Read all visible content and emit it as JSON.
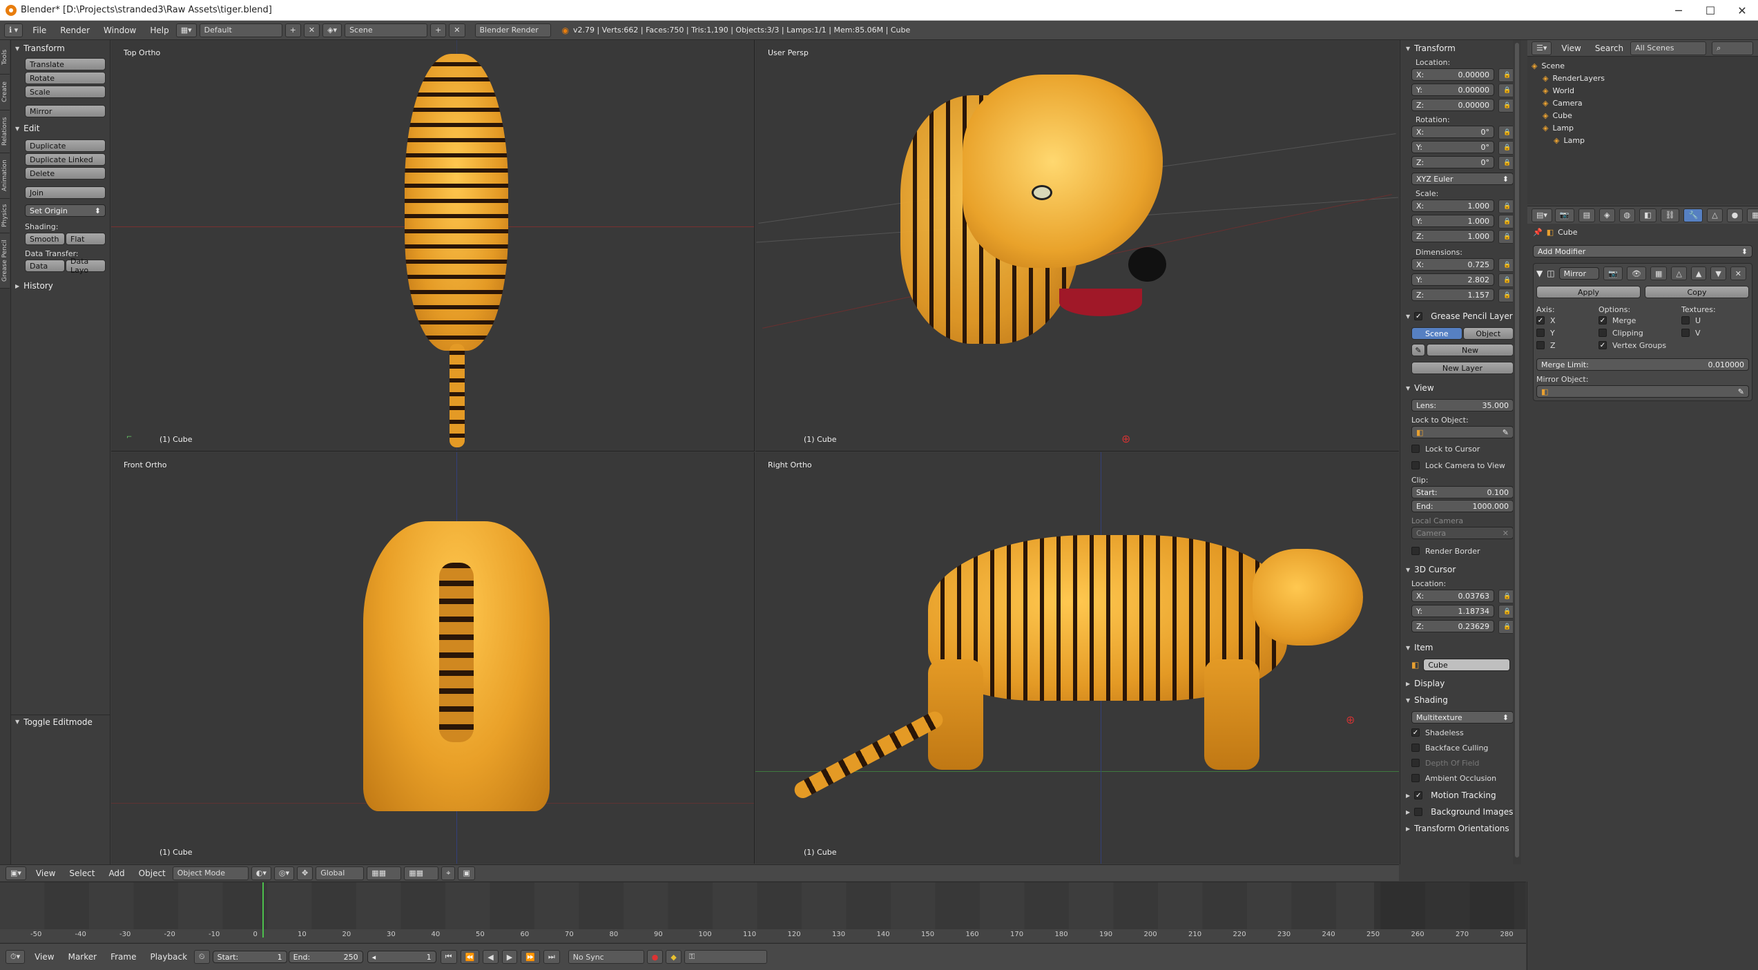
{
  "window": {
    "title": "Blender* [D:\\Projects\\stranded3\\Raw Assets\\tiger.blend]",
    "minimize": "─",
    "maximize": "☐",
    "close": "✕"
  },
  "infobar": {
    "menus": [
      "File",
      "Render",
      "Window",
      "Help"
    ],
    "layout": "Default",
    "scene": "Scene",
    "engine": "Blender Render",
    "stats": "v2.79 | Verts:662 | Faces:750 | Tris:1,190 | Objects:3/3 | Lamps:1/1 | Mem:85.06M | Cube"
  },
  "tools": {
    "tabs": [
      "Tools",
      "Create",
      "Relations",
      "Animation",
      "Physics",
      "Grease Pencil"
    ],
    "transform_header": "Transform",
    "transform": [
      "Translate",
      "Rotate",
      "Scale",
      "Mirror"
    ],
    "edit_header": "Edit",
    "edit": [
      "Duplicate",
      "Duplicate Linked",
      "Delete",
      "Join"
    ],
    "set_origin": "Set Origin",
    "shading_label": "Shading:",
    "shading": [
      "Smooth",
      "Flat"
    ],
    "data_transfer_label": "Data Transfer:",
    "data_transfer": [
      "Data",
      "Data Layo"
    ],
    "history": "History",
    "toggle_editmode": "Toggle Editmode"
  },
  "viewports": {
    "top": "Top Ortho",
    "persp": "User Persp",
    "front": "Front Ortho",
    "right": "Right Ortho",
    "object": "(1) Cube"
  },
  "view3d_header": {
    "menus": [
      "View",
      "Select",
      "Add",
      "Object"
    ],
    "mode": "Object Mode",
    "orientation": "Global"
  },
  "properties_n": {
    "transform": "Transform",
    "location_label": "Location:",
    "location": [
      {
        "axis": "X:",
        "value": "0.00000"
      },
      {
        "axis": "Y:",
        "value": "0.00000"
      },
      {
        "axis": "Z:",
        "value": "0.00000"
      }
    ],
    "rotation_label": "Rotation:",
    "rotation": [
      {
        "axis": "X:",
        "value": "0°"
      },
      {
        "axis": "Y:",
        "value": "0°"
      },
      {
        "axis": "Z:",
        "value": "0°"
      }
    ],
    "rotation_mode": "XYZ Euler",
    "scale_label": "Scale:",
    "scale": [
      {
        "axis": "X:",
        "value": "1.000"
      },
      {
        "axis": "Y:",
        "value": "1.000"
      },
      {
        "axis": "Z:",
        "value": "1.000"
      }
    ],
    "dimensions_label": "Dimensions:",
    "dimensions": [
      {
        "axis": "X:",
        "value": "0.725"
      },
      {
        "axis": "Y:",
        "value": "2.802"
      },
      {
        "axis": "Z:",
        "value": "1.157"
      }
    ],
    "grease_pencil": "Grease Pencil Layers",
    "gp_scene": "Scene",
    "gp_object": "Object",
    "gp_new": "New",
    "gp_new_layer": "New Layer",
    "view": "View",
    "lens_label": "Lens:",
    "lens": "35.000",
    "lock_to_object": "Lock to Object:",
    "lock_to_cursor": "Lock to Cursor",
    "lock_camera": "Lock Camera to View",
    "clip_label": "Clip:",
    "clip_start_label": "Start:",
    "clip_start": "0.100",
    "clip_end_label": "End:",
    "clip_end": "1000.000",
    "local_camera": "Local Camera",
    "camera": "Camera",
    "render_border": "Render Border",
    "cursor_header": "3D Cursor",
    "cursor_location": "Location:",
    "cursor": [
      {
        "axis": "X:",
        "value": "0.03763"
      },
      {
        "axis": "Y:",
        "value": "1.18734"
      },
      {
        "axis": "Z:",
        "value": "0.23629"
      }
    ],
    "item": "Item",
    "item_name": "Cube",
    "display": "Display",
    "shading": "Shading",
    "shading_mode": "Multitexture",
    "shadeless": "Shadeless",
    "backface": "Backface Culling",
    "dof": "Depth Of Field",
    "ao": "Ambient Occlusion",
    "motion_tracking": "Motion Tracking",
    "background_images": "Background Images",
    "transform_orientations": "Transform Orientations"
  },
  "outliner": {
    "menus": [
      "View",
      "Search"
    ],
    "filter": "All Scenes",
    "items": [
      {
        "name": "Scene",
        "indent": 0
      },
      {
        "name": "RenderLayers",
        "indent": 1
      },
      {
        "name": "World",
        "indent": 1
      },
      {
        "name": "Camera",
        "indent": 1
      },
      {
        "name": "Cube",
        "indent": 1
      },
      {
        "name": "Lamp",
        "indent": 1
      },
      {
        "name": "Lamp",
        "indent": 2
      }
    ]
  },
  "modifiers": {
    "object": "Cube",
    "add_modifier": "Add Modifier",
    "name": "Mirror",
    "apply": "Apply",
    "copy": "Copy",
    "axis_label": "Axis:",
    "options_label": "Options:",
    "textures_label": "Textures:",
    "axis": [
      "X",
      "Y",
      "Z"
    ],
    "options": [
      "Merge",
      "Clipping",
      "Vertex Groups"
    ],
    "textures": [
      "U",
      "V"
    ],
    "merge_limit_label": "Merge Limit:",
    "merge_limit": "0.010000",
    "mirror_object": "Mirror Object:"
  },
  "timeline": {
    "ticks": [
      "-50",
      "-40",
      "-30",
      "-20",
      "-10",
      "0",
      "10",
      "20",
      "30",
      "40",
      "50",
      "60",
      "70",
      "80",
      "90",
      "100",
      "110",
      "120",
      "130",
      "140",
      "150",
      "160",
      "170",
      "180",
      "190",
      "200",
      "210",
      "220",
      "230",
      "240",
      "250",
      "260",
      "270",
      "280"
    ],
    "menus": [
      "View",
      "Marker",
      "Frame",
      "Playback"
    ],
    "start_label": "Start:",
    "start": "1",
    "end_label": "End:",
    "end": "250",
    "current": "1",
    "sync": "No Sync"
  },
  "colors": {
    "accent": "#5680c2",
    "viewport": "#393939",
    "panel": "#3d3d3d"
  }
}
